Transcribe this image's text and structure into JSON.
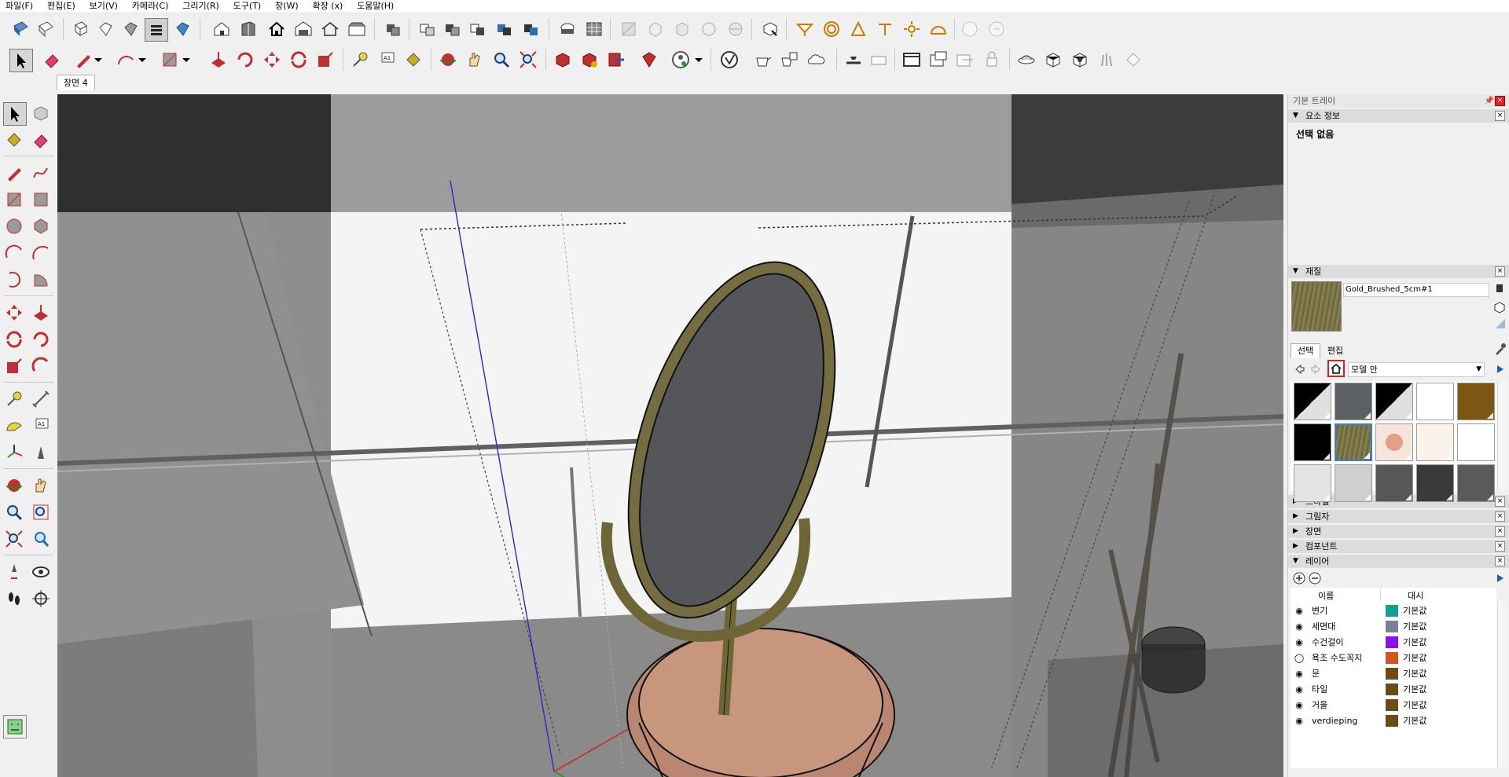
{
  "menu": [
    "파일(F)",
    "편집(E)",
    "보기(V)",
    "카메라(C)",
    "그리기(R)",
    "도구(T)",
    "창(W)",
    "확장 (x)",
    "도움말(H)"
  ],
  "scene_tab": "장면 4",
  "tray": {
    "title": "기본 트레이",
    "entity_info": {
      "header": "요소 정보",
      "selection": "선택 없음"
    },
    "materials": {
      "header": "재질",
      "current_name": "Gold_Brushed_5cm#1",
      "tab_select": "선택",
      "tab_edit": "편집",
      "library": "모델 안",
      "swatches": [
        [
          "#202020",
          "#5d6163",
          "#1f1f1f",
          "#ffffff",
          "#7c5714"
        ],
        [
          "#000000",
          "#7a7548",
          "#f5e5dc",
          "#fbf2ec",
          "#ffffff"
        ],
        [
          "#e4e4e4",
          "#cfcfcf",
          "#575757",
          "#3a3a3a",
          "#5a5a5a"
        ]
      ]
    },
    "collapsed_panels": [
      "스타일",
      "그림자",
      "장면",
      "컴포넌트"
    ],
    "layers": {
      "header": "레이어",
      "col_name": "이름",
      "col_dash": "대시",
      "rows": [
        {
          "name": "변기",
          "color": "#10a090",
          "dash": "기본값",
          "visible": true
        },
        {
          "name": "세면대",
          "color": "#7d7d9c",
          "dash": "기본값",
          "visible": true
        },
        {
          "name": "수건걸이",
          "color": "#8b10f0",
          "dash": "기본값",
          "visible": true
        },
        {
          "name": "욕조 수도꼭지",
          "color": "#d4541a",
          "dash": "기본값",
          "visible": false
        },
        {
          "name": "문",
          "color": "#6e4a15",
          "dash": "기본값",
          "visible": true
        },
        {
          "name": "타일",
          "color": "#6e4a15",
          "dash": "기본값",
          "visible": true
        },
        {
          "name": "거울",
          "color": "#6e4a15",
          "dash": "기본값",
          "visible": true
        },
        {
          "name": "verdieping",
          "color": "#6e4a15",
          "dash": "기본값",
          "visible": true
        }
      ]
    }
  },
  "icons": {
    "toolbar1": [
      "file-new-icon",
      "file-open-icon",
      "iso-view-icon",
      "top-view-icon",
      "front-view-icon",
      "layer-icon",
      "shaded-icon",
      "house-icon",
      "house2-icon",
      "home-icon",
      "warehouse-icon",
      "components-icon",
      "sandbox-icon"
    ]
  }
}
